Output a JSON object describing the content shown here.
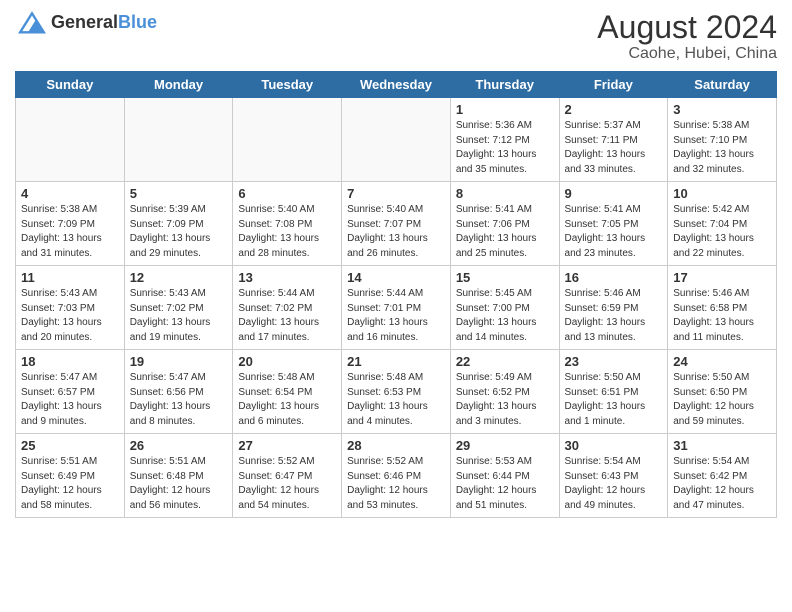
{
  "header": {
    "logo_general": "General",
    "logo_blue": "Blue",
    "month_year": "August 2024",
    "location": "Caohe, Hubei, China"
  },
  "weekdays": [
    "Sunday",
    "Monday",
    "Tuesday",
    "Wednesday",
    "Thursday",
    "Friday",
    "Saturday"
  ],
  "weeks": [
    [
      {
        "day": "",
        "info": "",
        "empty": true
      },
      {
        "day": "",
        "info": "",
        "empty": true
      },
      {
        "day": "",
        "info": "",
        "empty": true
      },
      {
        "day": "",
        "info": "",
        "empty": true
      },
      {
        "day": "1",
        "info": "Sunrise: 5:36 AM\nSunset: 7:12 PM\nDaylight: 13 hours\nand 35 minutes."
      },
      {
        "day": "2",
        "info": "Sunrise: 5:37 AM\nSunset: 7:11 PM\nDaylight: 13 hours\nand 33 minutes."
      },
      {
        "day": "3",
        "info": "Sunrise: 5:38 AM\nSunset: 7:10 PM\nDaylight: 13 hours\nand 32 minutes."
      }
    ],
    [
      {
        "day": "4",
        "info": "Sunrise: 5:38 AM\nSunset: 7:09 PM\nDaylight: 13 hours\nand 31 minutes."
      },
      {
        "day": "5",
        "info": "Sunrise: 5:39 AM\nSunset: 7:09 PM\nDaylight: 13 hours\nand 29 minutes."
      },
      {
        "day": "6",
        "info": "Sunrise: 5:40 AM\nSunset: 7:08 PM\nDaylight: 13 hours\nand 28 minutes."
      },
      {
        "day": "7",
        "info": "Sunrise: 5:40 AM\nSunset: 7:07 PM\nDaylight: 13 hours\nand 26 minutes."
      },
      {
        "day": "8",
        "info": "Sunrise: 5:41 AM\nSunset: 7:06 PM\nDaylight: 13 hours\nand 25 minutes."
      },
      {
        "day": "9",
        "info": "Sunrise: 5:41 AM\nSunset: 7:05 PM\nDaylight: 13 hours\nand 23 minutes."
      },
      {
        "day": "10",
        "info": "Sunrise: 5:42 AM\nSunset: 7:04 PM\nDaylight: 13 hours\nand 22 minutes."
      }
    ],
    [
      {
        "day": "11",
        "info": "Sunrise: 5:43 AM\nSunset: 7:03 PM\nDaylight: 13 hours\nand 20 minutes."
      },
      {
        "day": "12",
        "info": "Sunrise: 5:43 AM\nSunset: 7:02 PM\nDaylight: 13 hours\nand 19 minutes."
      },
      {
        "day": "13",
        "info": "Sunrise: 5:44 AM\nSunset: 7:02 PM\nDaylight: 13 hours\nand 17 minutes."
      },
      {
        "day": "14",
        "info": "Sunrise: 5:44 AM\nSunset: 7:01 PM\nDaylight: 13 hours\nand 16 minutes."
      },
      {
        "day": "15",
        "info": "Sunrise: 5:45 AM\nSunset: 7:00 PM\nDaylight: 13 hours\nand 14 minutes."
      },
      {
        "day": "16",
        "info": "Sunrise: 5:46 AM\nSunset: 6:59 PM\nDaylight: 13 hours\nand 13 minutes."
      },
      {
        "day": "17",
        "info": "Sunrise: 5:46 AM\nSunset: 6:58 PM\nDaylight: 13 hours\nand 11 minutes."
      }
    ],
    [
      {
        "day": "18",
        "info": "Sunrise: 5:47 AM\nSunset: 6:57 PM\nDaylight: 13 hours\nand 9 minutes."
      },
      {
        "day": "19",
        "info": "Sunrise: 5:47 AM\nSunset: 6:56 PM\nDaylight: 13 hours\nand 8 minutes."
      },
      {
        "day": "20",
        "info": "Sunrise: 5:48 AM\nSunset: 6:54 PM\nDaylight: 13 hours\nand 6 minutes."
      },
      {
        "day": "21",
        "info": "Sunrise: 5:48 AM\nSunset: 6:53 PM\nDaylight: 13 hours\nand 4 minutes."
      },
      {
        "day": "22",
        "info": "Sunrise: 5:49 AM\nSunset: 6:52 PM\nDaylight: 13 hours\nand 3 minutes."
      },
      {
        "day": "23",
        "info": "Sunrise: 5:50 AM\nSunset: 6:51 PM\nDaylight: 13 hours\nand 1 minute."
      },
      {
        "day": "24",
        "info": "Sunrise: 5:50 AM\nSunset: 6:50 PM\nDaylight: 12 hours\nand 59 minutes."
      }
    ],
    [
      {
        "day": "25",
        "info": "Sunrise: 5:51 AM\nSunset: 6:49 PM\nDaylight: 12 hours\nand 58 minutes."
      },
      {
        "day": "26",
        "info": "Sunrise: 5:51 AM\nSunset: 6:48 PM\nDaylight: 12 hours\nand 56 minutes."
      },
      {
        "day": "27",
        "info": "Sunrise: 5:52 AM\nSunset: 6:47 PM\nDaylight: 12 hours\nand 54 minutes."
      },
      {
        "day": "28",
        "info": "Sunrise: 5:52 AM\nSunset: 6:46 PM\nDaylight: 12 hours\nand 53 minutes."
      },
      {
        "day": "29",
        "info": "Sunrise: 5:53 AM\nSunset: 6:44 PM\nDaylight: 12 hours\nand 51 minutes."
      },
      {
        "day": "30",
        "info": "Sunrise: 5:54 AM\nSunset: 6:43 PM\nDaylight: 12 hours\nand 49 minutes."
      },
      {
        "day": "31",
        "info": "Sunrise: 5:54 AM\nSunset: 6:42 PM\nDaylight: 12 hours\nand 47 minutes."
      }
    ]
  ]
}
